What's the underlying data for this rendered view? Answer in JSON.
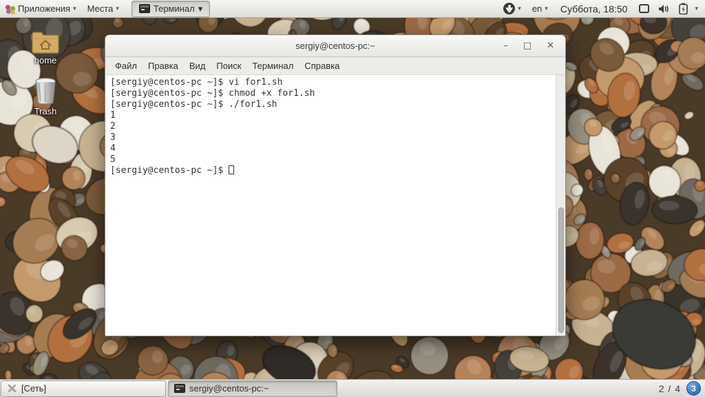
{
  "top_panel": {
    "applications_label": "Приложения",
    "places_label": "Места",
    "active_app_label": "Терминал",
    "caret": "▾",
    "language": "en",
    "clock": "Суббота, 18:50"
  },
  "desktop": {
    "icons": [
      {
        "name": "home",
        "label": "home"
      },
      {
        "name": "trash",
        "label": "Trash"
      }
    ]
  },
  "terminal_window": {
    "title": "sergiy@centos-pc:~",
    "window_buttons": {
      "minimize": "–",
      "maximize": "□",
      "close": "✕"
    },
    "menu": [
      {
        "name": "file",
        "label": "Файл"
      },
      {
        "name": "edit",
        "label": "Правка"
      },
      {
        "name": "view",
        "label": "Вид"
      },
      {
        "name": "search",
        "label": "Поиск"
      },
      {
        "name": "terminal",
        "label": "Терминал"
      },
      {
        "name": "help",
        "label": "Справка"
      }
    ],
    "lines": [
      "[sergiy@centos-pc ~]$ vi for1.sh",
      "[sergiy@centos-pc ~]$ chmod +x for1.sh",
      "[sergiy@centos-pc ~]$ ./for1.sh",
      "1",
      "2",
      "3",
      "4",
      "5"
    ],
    "prompt_line": "[sergiy@centos-pc ~]$ "
  },
  "taskbar": {
    "items": [
      {
        "label": "[Сеть]",
        "active": false
      },
      {
        "label": "sergiy@centos-pc:~",
        "active": true
      }
    ],
    "workspace_indicator": "2 / 4",
    "pager_badge": "3"
  },
  "colors": {
    "panel_bg": "#e9e9e6",
    "terminal_bg": "#ffffff",
    "terminal_fg": "#2e3436",
    "badge_blue": "#2f6fbe",
    "titlebar_bg": "#f0f0ee"
  }
}
